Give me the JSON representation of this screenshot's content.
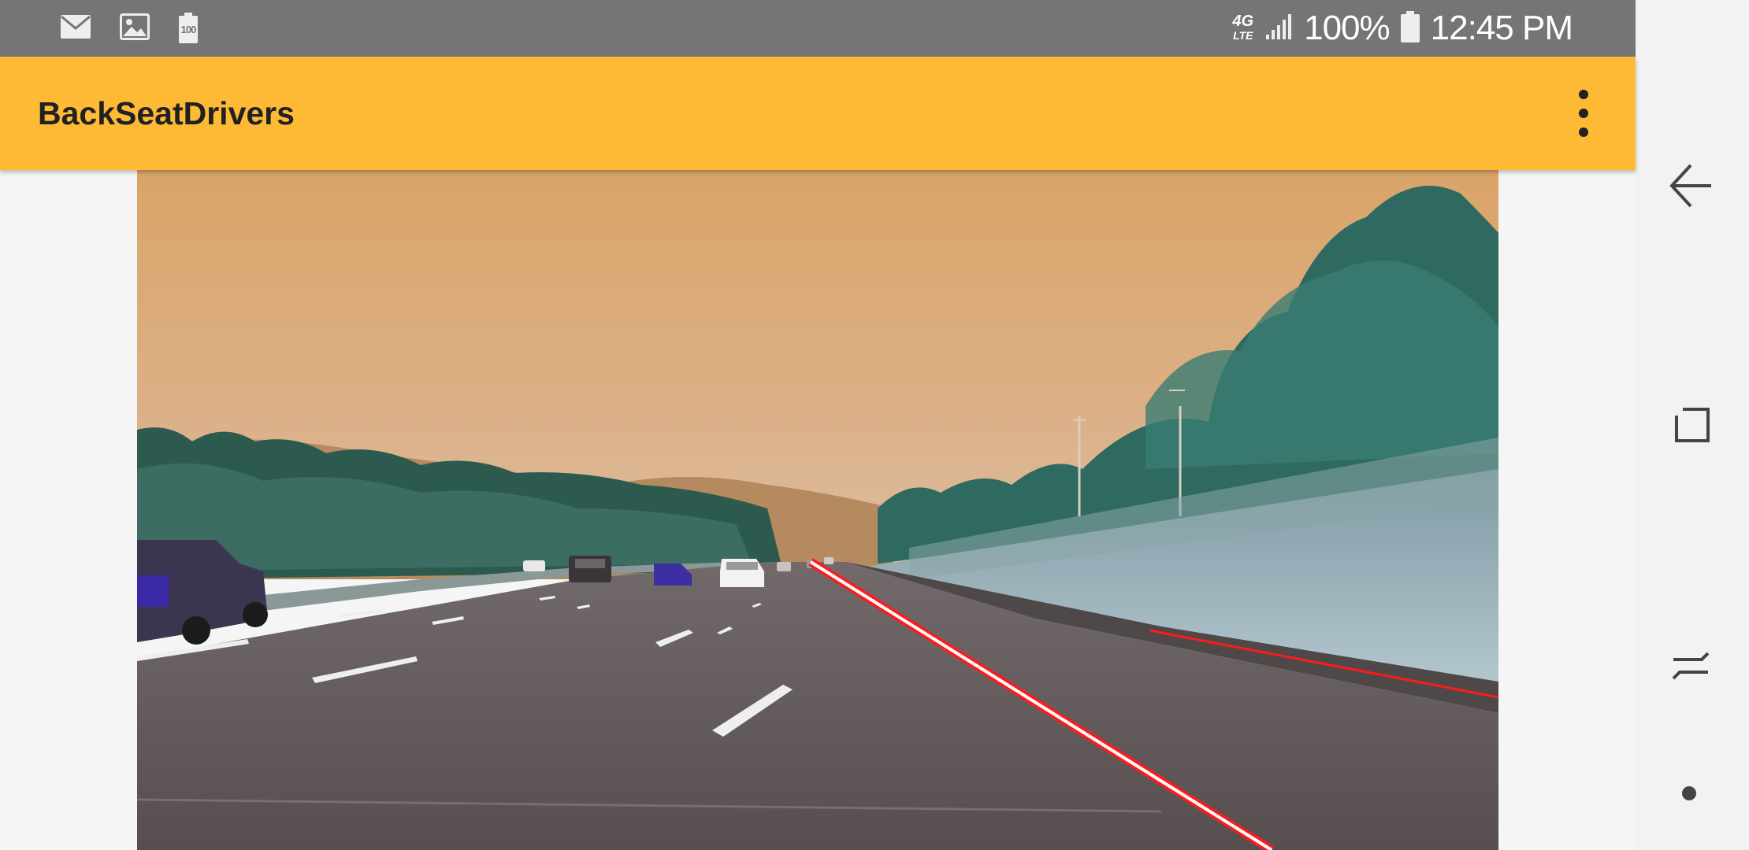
{
  "status_bar": {
    "notification_icons": [
      "mail-icon",
      "image-icon",
      "battery-saver-icon"
    ],
    "battery_saver_badge": "100",
    "network_label_top": "4G",
    "network_label_bottom": "LTE",
    "signal_icon": "signal-icon",
    "battery_percent": "100%",
    "battery_icon": "battery-icon",
    "time": "12:45 PM"
  },
  "app_bar": {
    "title": "BackSeatDrivers",
    "overflow_icon": "more-vert-icon",
    "background_color": "#ffba35"
  },
  "camera_view": {
    "description_icon": "camera-feed",
    "overlay_line_color": "#ff1a1a"
  },
  "nav_bar": {
    "buttons": [
      "back-icon",
      "recents-icon",
      "switch-icon",
      "dot-icon"
    ]
  }
}
